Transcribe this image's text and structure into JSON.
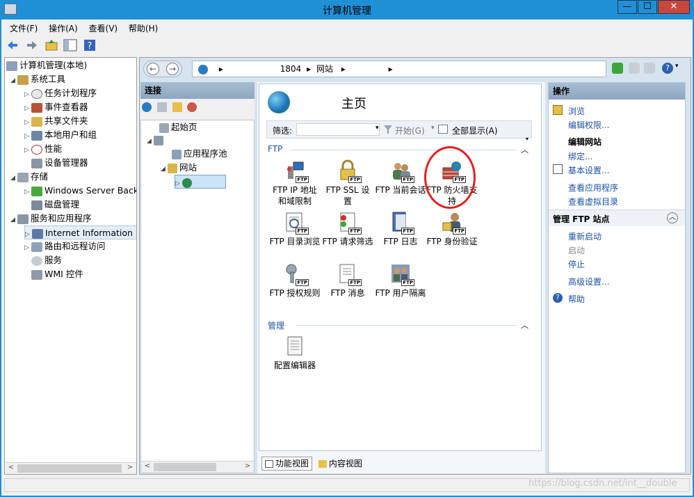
{
  "window": {
    "title": "计算机管理",
    "min": "—",
    "max": "☐",
    "close": "✕"
  },
  "menu": [
    "文件(F)",
    "操作(A)",
    "查看(V)",
    "帮助(H)"
  ],
  "tree": {
    "root": "计算机管理(本地)",
    "system_tools": "系统工具",
    "task_scheduler": "任务计划程序",
    "event_viewer": "事件查看器",
    "shared_folders": "共享文件夹",
    "local_users": "本地用户和组",
    "performance": "性能",
    "device_manager": "设备管理器",
    "storage": "存储",
    "wsb": "Windows Server Back",
    "disk_mgmt": "磁盘管理",
    "services_apps": "服务和应用程序",
    "iis": "Internet Information S",
    "routing": "路由和远程访问",
    "services": "服务",
    "wmi": "WMI 控件"
  },
  "address": {
    "node": "1804",
    "site": "网站"
  },
  "connections": {
    "header": "连接",
    "start": "起始页",
    "app_pools": "应用程序池",
    "sites": "网站"
  },
  "main": {
    "title": "主页",
    "filter_label": "筛选:",
    "start": "开始(G)",
    "show_all": "全部显示(A)",
    "group_ftp": "FTP",
    "group_manage": "管理",
    "features": [
      {
        "label": "FTP IP 地址和域限制"
      },
      {
        "label": "FTP SSL 设置"
      },
      {
        "label": "FTP 当前会话"
      },
      {
        "label": "FTP 防火墙支持"
      },
      {
        "label": "FTP 目录浏览"
      },
      {
        "label": "FTP 请求筛选"
      },
      {
        "label": "FTP 日志"
      },
      {
        "label": "FTP 身份验证"
      },
      {
        "label": "FTP 授权规则"
      },
      {
        "label": "FTP 消息"
      },
      {
        "label": "FTP 用户隔离"
      }
    ],
    "config_editor": "配置编辑器"
  },
  "tabs": {
    "features_view": "功能视图",
    "content_view": "内容视图"
  },
  "actions": {
    "header": "操作",
    "browse": "浏览",
    "edit_permissions": "编辑权限...",
    "edit_site": "编辑网站",
    "bindings": "绑定...",
    "basic_settings": "基本设置...",
    "view_apps": "查看应用程序",
    "view_vdirs": "查看虚拟目录",
    "manage_ftp": "管理 FTP 站点",
    "restart": "重新启动",
    "start": "启动",
    "stop": "停止",
    "advanced": "高级设置...",
    "help": "帮助"
  },
  "watermark": "https://blog.csdn.net/int__double",
  "colors": {
    "titlebar": "#1f8fd6",
    "link": "#1c52a0",
    "highlight_circle": "#e02020"
  }
}
